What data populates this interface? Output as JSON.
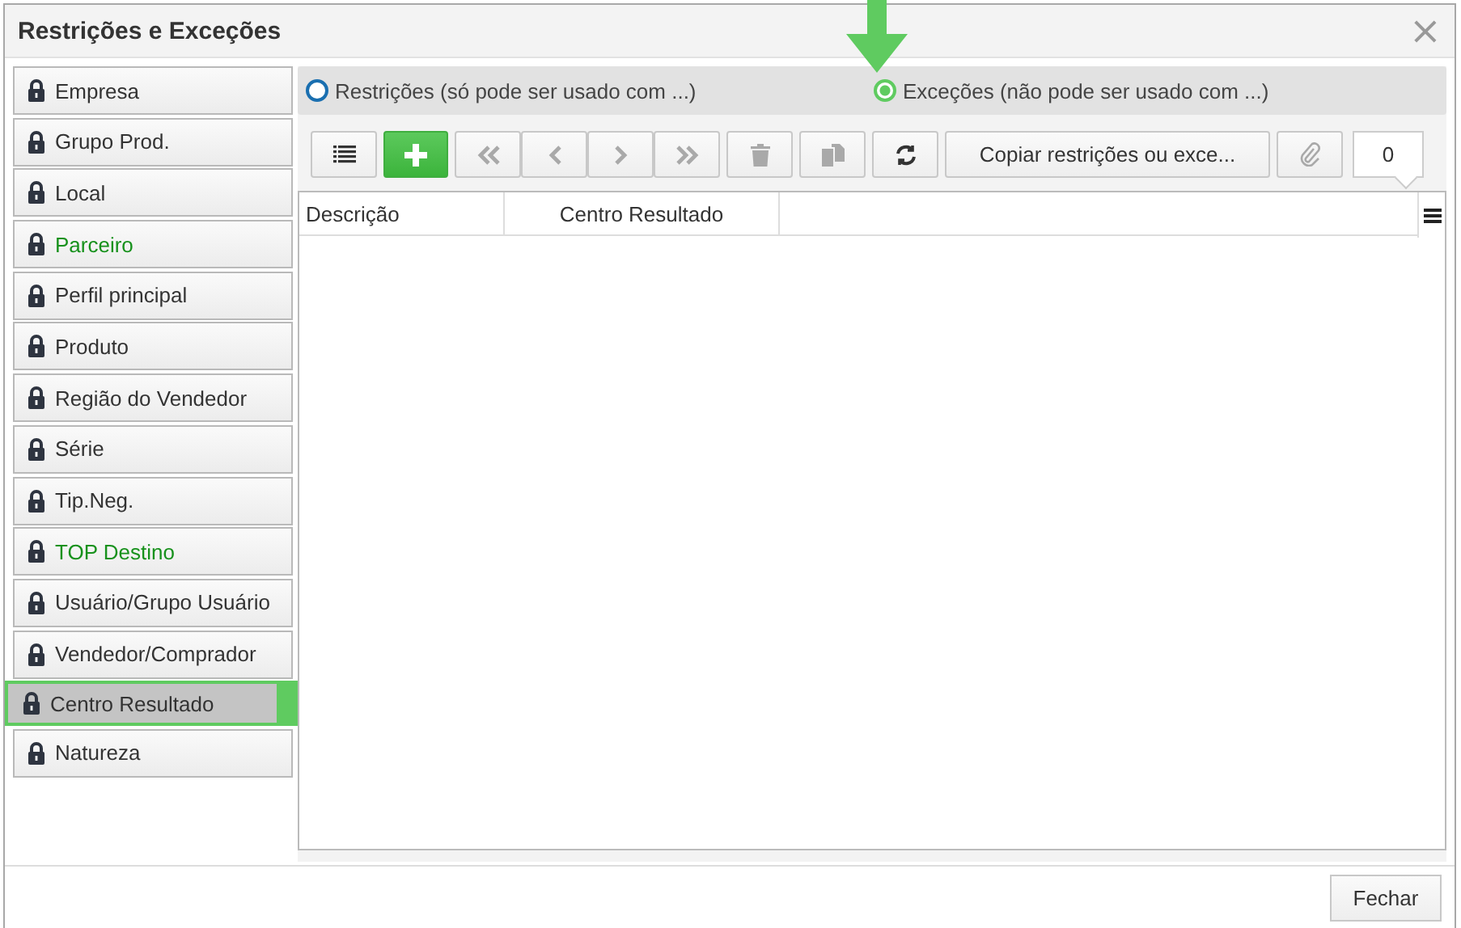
{
  "window": {
    "title": "Restrições e Exceções",
    "close": "×"
  },
  "sidebar": {
    "items": [
      {
        "label": "Empresa",
        "highlighted": false,
        "selected": false
      },
      {
        "label": "Grupo Prod.",
        "highlighted": false,
        "selected": false
      },
      {
        "label": "Local",
        "highlighted": false,
        "selected": false
      },
      {
        "label": "Parceiro",
        "highlighted": true,
        "selected": false
      },
      {
        "label": "Perfil principal",
        "highlighted": false,
        "selected": false
      },
      {
        "label": "Produto",
        "highlighted": false,
        "selected": false
      },
      {
        "label": "Região do Vendedor",
        "highlighted": false,
        "selected": false
      },
      {
        "label": "Série",
        "highlighted": false,
        "selected": false
      },
      {
        "label": "Tip.Neg.",
        "highlighted": false,
        "selected": false
      },
      {
        "label": "TOP Destino",
        "highlighted": true,
        "selected": false
      },
      {
        "label": "Usuário/Grupo Usuário",
        "highlighted": false,
        "selected": false
      },
      {
        "label": "Vendedor/Comprador",
        "highlighted": false,
        "selected": false
      },
      {
        "label": "Centro Resultado",
        "highlighted": false,
        "selected": true
      },
      {
        "label": "Natureza",
        "highlighted": false,
        "selected": false
      }
    ]
  },
  "mode_options": [
    {
      "label": "Restrições (só pode ser usado com ...)",
      "selected": false
    },
    {
      "label": "Exceções (não pode ser usado com ...)",
      "selected": true
    }
  ],
  "toolbar": [
    {
      "kind": "list",
      "disabled": false
    },
    {
      "kind": "add",
      "disabled": false
    },
    {
      "kind": "first",
      "disabled": true
    },
    {
      "kind": "prev",
      "disabled": true
    },
    {
      "kind": "next",
      "disabled": true
    },
    {
      "kind": "last",
      "disabled": true
    },
    {
      "kind": "delete",
      "disabled": true
    },
    {
      "kind": "duplicate",
      "disabled": true
    },
    {
      "kind": "refresh",
      "disabled": false
    },
    {
      "kind": "text",
      "label": "Copiar restrições ou exce...",
      "disabled": false
    },
    {
      "kind": "attach",
      "disabled": true
    }
  ],
  "record_count": "0",
  "table": {
    "columns": [
      "Descrição",
      "Centro Resultado"
    ]
  },
  "footer": {
    "close_button": "Fechar"
  }
}
